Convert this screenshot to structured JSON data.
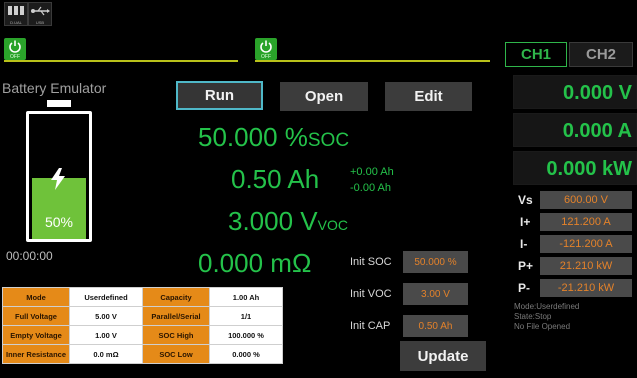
{
  "top_icons": [
    {
      "name": "dual-channel-icon",
      "label": "D.UAL"
    },
    {
      "name": "usb-icon",
      "label": "USB"
    }
  ],
  "power": {
    "ch1_label": "OFF",
    "ch2_label": "OFF"
  },
  "app": {
    "title": "Battery Emulator"
  },
  "toolbar": {
    "run_label": "Run",
    "open_label": "Open",
    "edit_label": "Edit"
  },
  "battery": {
    "percent_label": "50%",
    "charge_level": 0.5,
    "elapsed": "00:00:00"
  },
  "readouts": {
    "soc_value": "50.000 %",
    "soc_unit": "SOC",
    "ah_value": "0.50 Ah",
    "ah_plus": "+0.00 Ah",
    "ah_minus": "-0.00 Ah",
    "voc_value": "3.000 V",
    "voc_unit": "VOC",
    "res_value": "0.000 mΩ"
  },
  "params": {
    "rows": [
      {
        "l1": "Mode",
        "v1": "Userdefined",
        "l2": "Capacity",
        "v2": "1.00 Ah"
      },
      {
        "l1": "Full Voltage",
        "v1": "5.00 V",
        "l2": "Parallel/Serial",
        "v2": "1/1"
      },
      {
        "l1": "Empty Voltage",
        "v1": "1.00 V",
        "l2": "SOC High",
        "v2": "100.000 %"
      },
      {
        "l1": "Inner Resistance",
        "v1": "0.0 mΩ",
        "l2": "SOC Low",
        "v2": "0.000 %"
      }
    ]
  },
  "init": {
    "soc_label": "Init SOC",
    "soc_value": "50.000 %",
    "voc_label": "Init VOC",
    "voc_value": "3.00 V",
    "cap_label": "Init CAP",
    "cap_value": "0.50 Ah",
    "update_label": "Update"
  },
  "right": {
    "tab1": "CH1",
    "tab2": "CH2",
    "voltage": "0.000 V",
    "current": "0.000 A",
    "power": "0.000 kW",
    "limits": [
      {
        "label": "Vs",
        "value": "600.00 V"
      },
      {
        "label": "I+",
        "value": "121.200 A"
      },
      {
        "label": "I-",
        "value": "-121.200 A"
      },
      {
        "label": "P+",
        "value": "21.210 kW"
      },
      {
        "label": "P-",
        "value": "-21.210 kW"
      }
    ],
    "status_mode": "Mode:Userdefined",
    "status_state": "State:Stop",
    "status_file": "No File Opened"
  },
  "colors": {
    "accent_green": "#24c24a",
    "orange": "#e58a18",
    "value_orange": "#e4822a",
    "run_border": "#4fb8c8",
    "divider_yellow": "#b9c21a"
  }
}
